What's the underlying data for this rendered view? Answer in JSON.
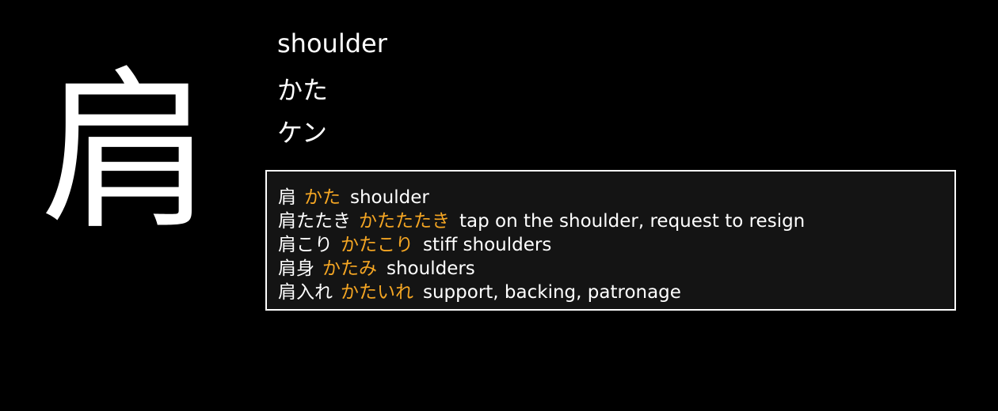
{
  "kanji": "肩",
  "meaning": "shoulder",
  "kun_reading": "かた",
  "on_reading": "ケン",
  "colors": {
    "background": "#000000",
    "text": "#ffffff",
    "reading_accent": "#f5a623",
    "panel_background": "#141414",
    "panel_border": "#ffffff"
  },
  "examples": [
    {
      "word": "肩",
      "reading": "かた",
      "gloss": "shoulder"
    },
    {
      "word": "肩たたき",
      "reading": "かたたたき",
      "gloss": "tap on the shoulder, request to resign"
    },
    {
      "word": "肩こり",
      "reading": "かたこり",
      "gloss": "stiff shoulders"
    },
    {
      "word": "肩身",
      "reading": "かたみ",
      "gloss": "shoulders"
    },
    {
      "word": "肩入れ",
      "reading": "かたいれ",
      "gloss": "support, backing, patronage"
    }
  ]
}
